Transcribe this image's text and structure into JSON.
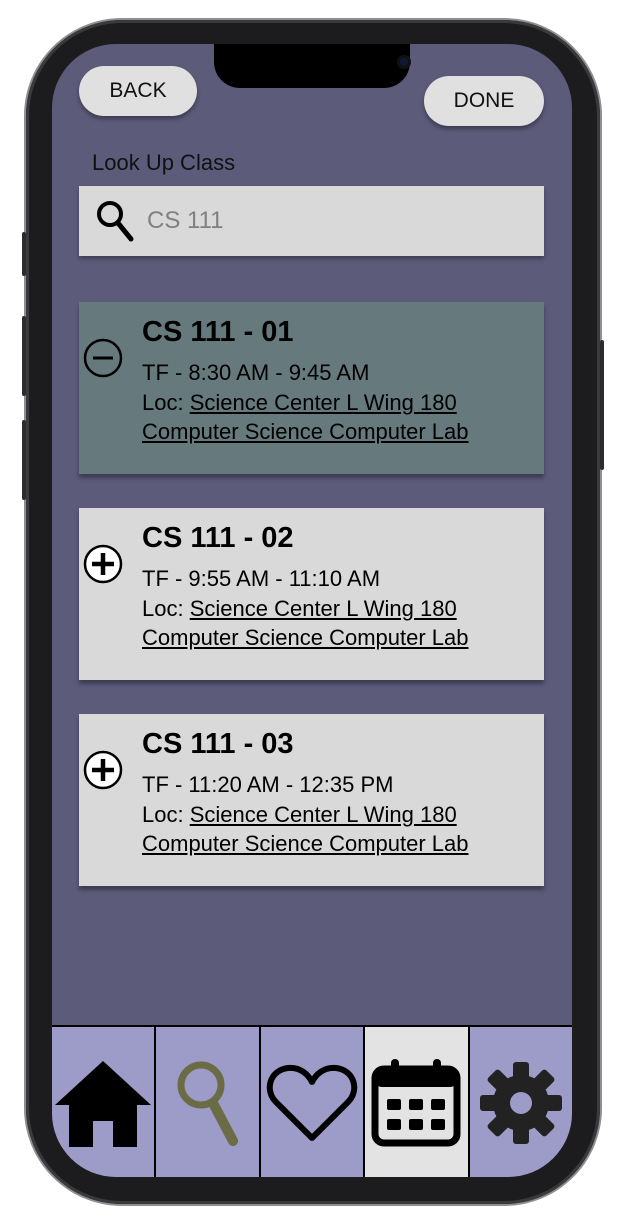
{
  "header": {
    "back_label": "BACK",
    "done_label": "DONE"
  },
  "search": {
    "label": "Look Up Class",
    "value": "CS 111"
  },
  "results": [
    {
      "title": "CS 111 - 01",
      "time": "TF - 8:30 AM - 9:45 AM",
      "loc_prefix": "Loc: ",
      "location_line1": "Science Center L Wing 180",
      "location_line2": "Computer Science Computer Lab",
      "state": "added",
      "toggle_icon": "minus-circle-icon"
    },
    {
      "title": "CS 111 - 02",
      "time": "TF - 9:55 AM - 11:10 AM",
      "loc_prefix": "Loc: ",
      "location_line1": "Science Center L Wing 180",
      "location_line2": "Computer Science Computer Lab",
      "state": "not-added",
      "toggle_icon": "plus-circle-icon"
    },
    {
      "title": "CS 111 - 03",
      "time": "TF - 11:20 AM - 12:35 PM",
      "loc_prefix": "Loc: ",
      "location_line1": "Science Center L Wing 180",
      "location_line2": "Computer Science Computer Lab",
      "state": "not-added",
      "toggle_icon": "plus-circle-icon"
    }
  ],
  "tabbar": {
    "items": [
      {
        "icon": "home-icon",
        "active": false
      },
      {
        "icon": "search-icon",
        "active": false
      },
      {
        "icon": "heart-icon",
        "active": false
      },
      {
        "icon": "calendar-icon",
        "active": true
      },
      {
        "icon": "gear-icon",
        "active": false
      }
    ]
  },
  "colors": {
    "screen_bg": "#5c5b7a",
    "card_bg": "#d9d9d9",
    "card_selected_bg": "#66797c",
    "tab_bg": "#9d9bc8",
    "tab_active_bg": "#e3e3e3",
    "search_tab_icon": "#6b6b45"
  }
}
